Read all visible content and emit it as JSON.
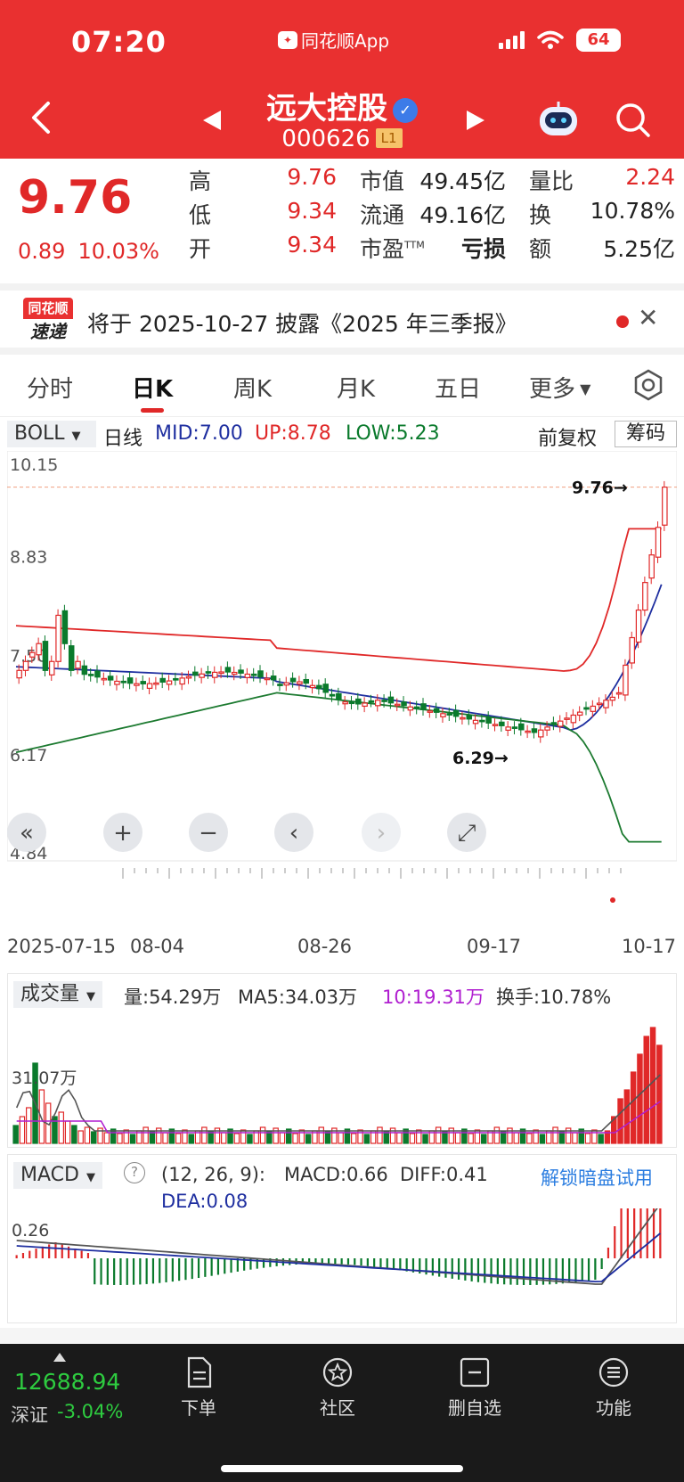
{
  "status": {
    "time": "07:20",
    "app_name": "同花顺App",
    "battery": "64"
  },
  "stock": {
    "name": "远大控股",
    "code": "000626",
    "level_badge": "L1"
  },
  "quote": {
    "price": "9.76",
    "change": "0.89",
    "change_pct": "10.03%",
    "high_label": "高",
    "high": "9.76",
    "low_label": "低",
    "low": "9.34",
    "open_label": "开",
    "open": "9.34",
    "mcap_label": "市值",
    "mcap": "49.45亿",
    "float_label": "流通",
    "float": "49.16亿",
    "pe_label": "市盈",
    "pe_sup": "TTM",
    "pe": "亏损",
    "vr_label": "量比",
    "vr": "2.24",
    "turnover_label": "换",
    "turnover": "10.78%",
    "amount_label": "额",
    "amount": "5.25亿"
  },
  "notice": {
    "logo_top": "同花顺",
    "logo_bottom": "速递",
    "text": "将于 2025-10-27 披露《2025 年三季报》"
  },
  "tabs": [
    "分时",
    "日K",
    "周K",
    "月K",
    "五日",
    "更多"
  ],
  "indicator_bar": {
    "select": "BOLL",
    "period": "日线",
    "mid": "MID:7.00",
    "up": "UP:8.78",
    "low": "LOW:5.23",
    "adjust": "前复权",
    "chips": "筹码"
  },
  "colors": {
    "up": "#e02828",
    "down": "#0a7a2c",
    "mid": "#1f2fa0",
    "low_band": "#1c7a30",
    "header": "#e93030"
  },
  "chart_data": {
    "type": "candlestick",
    "y_ticks": [
      "10.15",
      "8.83",
      "7.50",
      "6.17",
      "4.84"
    ],
    "ylim": [
      4.84,
      10.15
    ],
    "x_ticks": [
      "2025-07-15",
      "08-04",
      "08-26",
      "09-17",
      "10-17"
    ],
    "last_price_label": "9.76→",
    "low_price_label": "6.29→",
    "volume": {
      "select": "成交量",
      "vol": "量:54.29万",
      "ma5": "MA5:34.03万",
      "ma10": "10:19.31万",
      "turnover": "换手:10.78%",
      "tick": "31.07万"
    },
    "macd": {
      "select": "MACD",
      "params": "(12, 26, 9):",
      "macd": "MACD:0.66",
      "diff": "DIFF:0.41",
      "dea": "DEA:0.08",
      "tick": "0.26",
      "promo": "解锁暗盘试用"
    }
  },
  "chart_controls": {
    "collapse": "«",
    "zoom_in": "+",
    "zoom_out": "−",
    "prev": "‹",
    "next": "›",
    "fullscreen": "⤢"
  },
  "footer": {
    "index_value": "12688.94",
    "index_name": "深证",
    "index_change": "-3.04%",
    "buttons": [
      "下单",
      "社区",
      "删自选",
      "功能"
    ]
  }
}
